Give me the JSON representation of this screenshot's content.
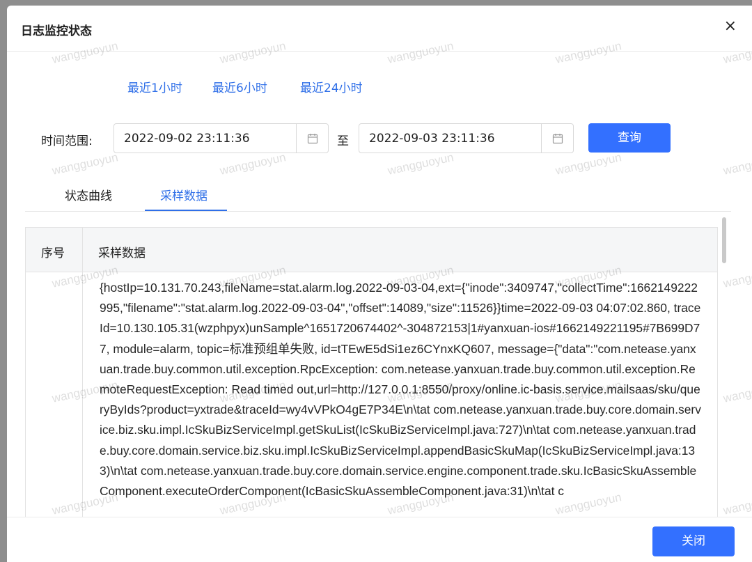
{
  "dialog": {
    "title": "日志监控状态",
    "close_icon": "close-icon",
    "close_glyph": "×"
  },
  "quick_ranges": [
    "最近1小时",
    "最近6小时",
    "最近24小时"
  ],
  "time_range": {
    "label": "时间范围:",
    "start": "2022-09-02 23:11:36",
    "separator": "至",
    "end": "2022-09-03 23:11:36",
    "calendar_icon": "calendar-icon",
    "query_label": "查询"
  },
  "tabs": {
    "items": [
      "状态曲线",
      "采样数据"
    ],
    "active": "采样数据"
  },
  "table": {
    "headers": [
      "序号",
      "采样数据"
    ],
    "rows": [
      {
        "no": "",
        "data": "{hostIp=10.131.70.243,fileName=stat.alarm.log.2022-09-03-04,ext={\"inode\":3409747,\"collectTime\":1662149222995,\"filename\":\"stat.alarm.log.2022-09-03-04\",\"offset\":14089,\"size\":11526}}time=2022-09-03 04:07:02.860, traceId=10.130.105.31(wzphpyx)unSample^1651720674402^-304872153|1#yanxuan-ios#1662149221195#7B699D77, module=alarm, topic=标准预组单失败, id=tTEwE5dSi1ez6CYnxKQ607, message={\"data\":\"com.netease.yanxuan.trade.buy.common.util.exception.RpcException: com.netease.yanxuan.trade.buy.common.util.exception.RemoteRequestException: Read timed out,url=http://127.0.0.1:8550/proxy/online.ic-basis.service.mailsaas/sku/queryByIds?product=yxtrade&traceId=wy4vVPkO4gE7P34E\\n\\tat com.netease.yanxuan.trade.buy.core.domain.service.biz.sku.impl.IcSkuBizServiceImpl.getSkuList(IcSkuBizServiceImpl.java:727)\\n\\tat com.netease.yanxuan.trade.buy.core.domain.service.biz.sku.impl.IcSkuBizServiceImpl.appendBasicSkuMap(IcSkuBizServiceImpl.java:133)\\n\\tat com.netease.yanxuan.trade.buy.core.domain.service.engine.component.trade.sku.IcBasicSkuAssembleComponent.executeOrderComponent(IcBasicSkuAssembleComponent.java:31)\\n\\tat c"
      }
    ]
  },
  "footer": {
    "close_label": "关闭"
  },
  "watermark": "wangguoyun",
  "colors": {
    "primary": "#3370ff",
    "link": "#2f6fe8",
    "mask": "#8e8e8e"
  }
}
